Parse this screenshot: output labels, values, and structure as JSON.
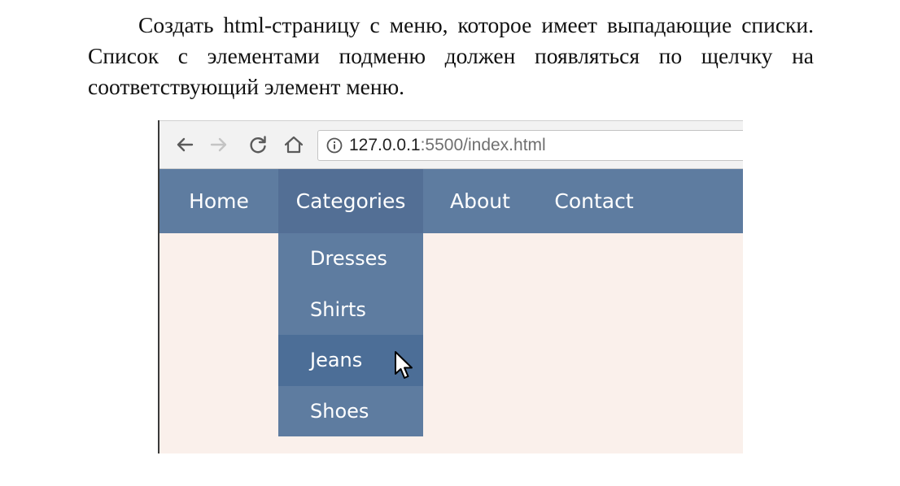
{
  "task_text": "Создать html-страницу с меню, которое имеет выпадающие списки. Список с элементами подменю должен появляться по щелчку на соответствующий элемент меню.",
  "browser": {
    "url_host": "127.0.0.1",
    "url_rest": ":5500/index.html",
    "toolbar_icons": [
      "back-arrow-icon",
      "forward-arrow-icon",
      "reload-icon",
      "home-icon",
      "info-icon"
    ]
  },
  "menu": {
    "items": [
      {
        "label": "Home"
      },
      {
        "label": "Categories",
        "active": true
      },
      {
        "label": "About"
      },
      {
        "label": "Contact"
      }
    ],
    "dropdown": [
      {
        "label": "Dresses"
      },
      {
        "label": "Shirts"
      },
      {
        "label": "Jeans",
        "hover": true
      },
      {
        "label": "Shoes"
      }
    ]
  },
  "colors": {
    "navbar": "#5e7ca0",
    "active": "#536f95",
    "hover": "#4c6e97",
    "page_bg": "#faf0eb"
  }
}
